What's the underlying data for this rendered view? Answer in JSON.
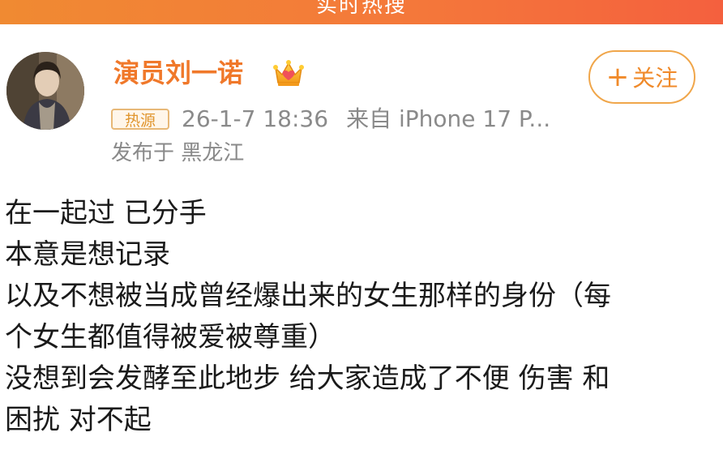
{
  "header": {
    "banner_title": "实时热搜"
  },
  "post": {
    "author_name": "演员刘一诺",
    "author_badge_icon": "crown-icon",
    "follow_label": "关注",
    "follow_plus": "+",
    "hot_badge": "热源",
    "timestamp": "26-1-7 18:36",
    "source": "来自 iPhone 17 P...",
    "location": "发布于 黑龙江",
    "content_lines": [
      "在一起过 已分手",
      "本意是想记录",
      "以及不想被当成曾经爆出来的女生那样的身份（每",
      "个女生都值得被爱被尊重）",
      "没想到会发酵至此地步 给大家造成了不便 伤害 和",
      "困扰 对不起"
    ]
  },
  "colors": {
    "accent_orange": "#f0782a",
    "banner_start": "#f08a32",
    "banner_end": "#f4603e",
    "meta_gray": "#8a8a8a"
  }
}
